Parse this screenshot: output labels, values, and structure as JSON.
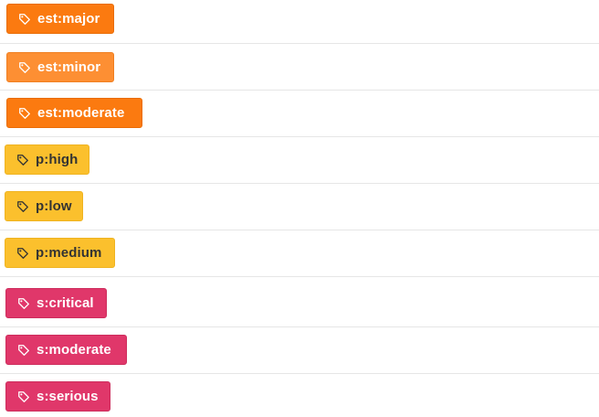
{
  "labels": [
    {
      "name": "est:major",
      "color": "#fb7a10",
      "border": "#e96c05",
      "text": "light"
    },
    {
      "name": "est:minor",
      "color": "#fd8f33",
      "border": "#f07f20",
      "text": "light"
    },
    {
      "name": "est:moderate",
      "color": "#fb7a10",
      "border": "#e96c05",
      "text": "light"
    },
    {
      "name": "p:high",
      "color": "#fbc02d",
      "border": "#efb320",
      "text": "dark"
    },
    {
      "name": "p:low",
      "color": "#fbc02d",
      "border": "#efb320",
      "text": "dark"
    },
    {
      "name": "p:medium",
      "color": "#fbc02d",
      "border": "#efb320",
      "text": "dark"
    },
    {
      "name": "s:critical",
      "color": "#e0376a",
      "border": "#cd2c5c",
      "text": "light"
    },
    {
      "name": "s:moderate",
      "color": "#e0376a",
      "border": "#cd2c5c",
      "text": "light"
    },
    {
      "name": "s:serious",
      "color": "#e0376a",
      "border": "#cd2c5c",
      "text": "light"
    }
  ],
  "icon": "tag-icon"
}
